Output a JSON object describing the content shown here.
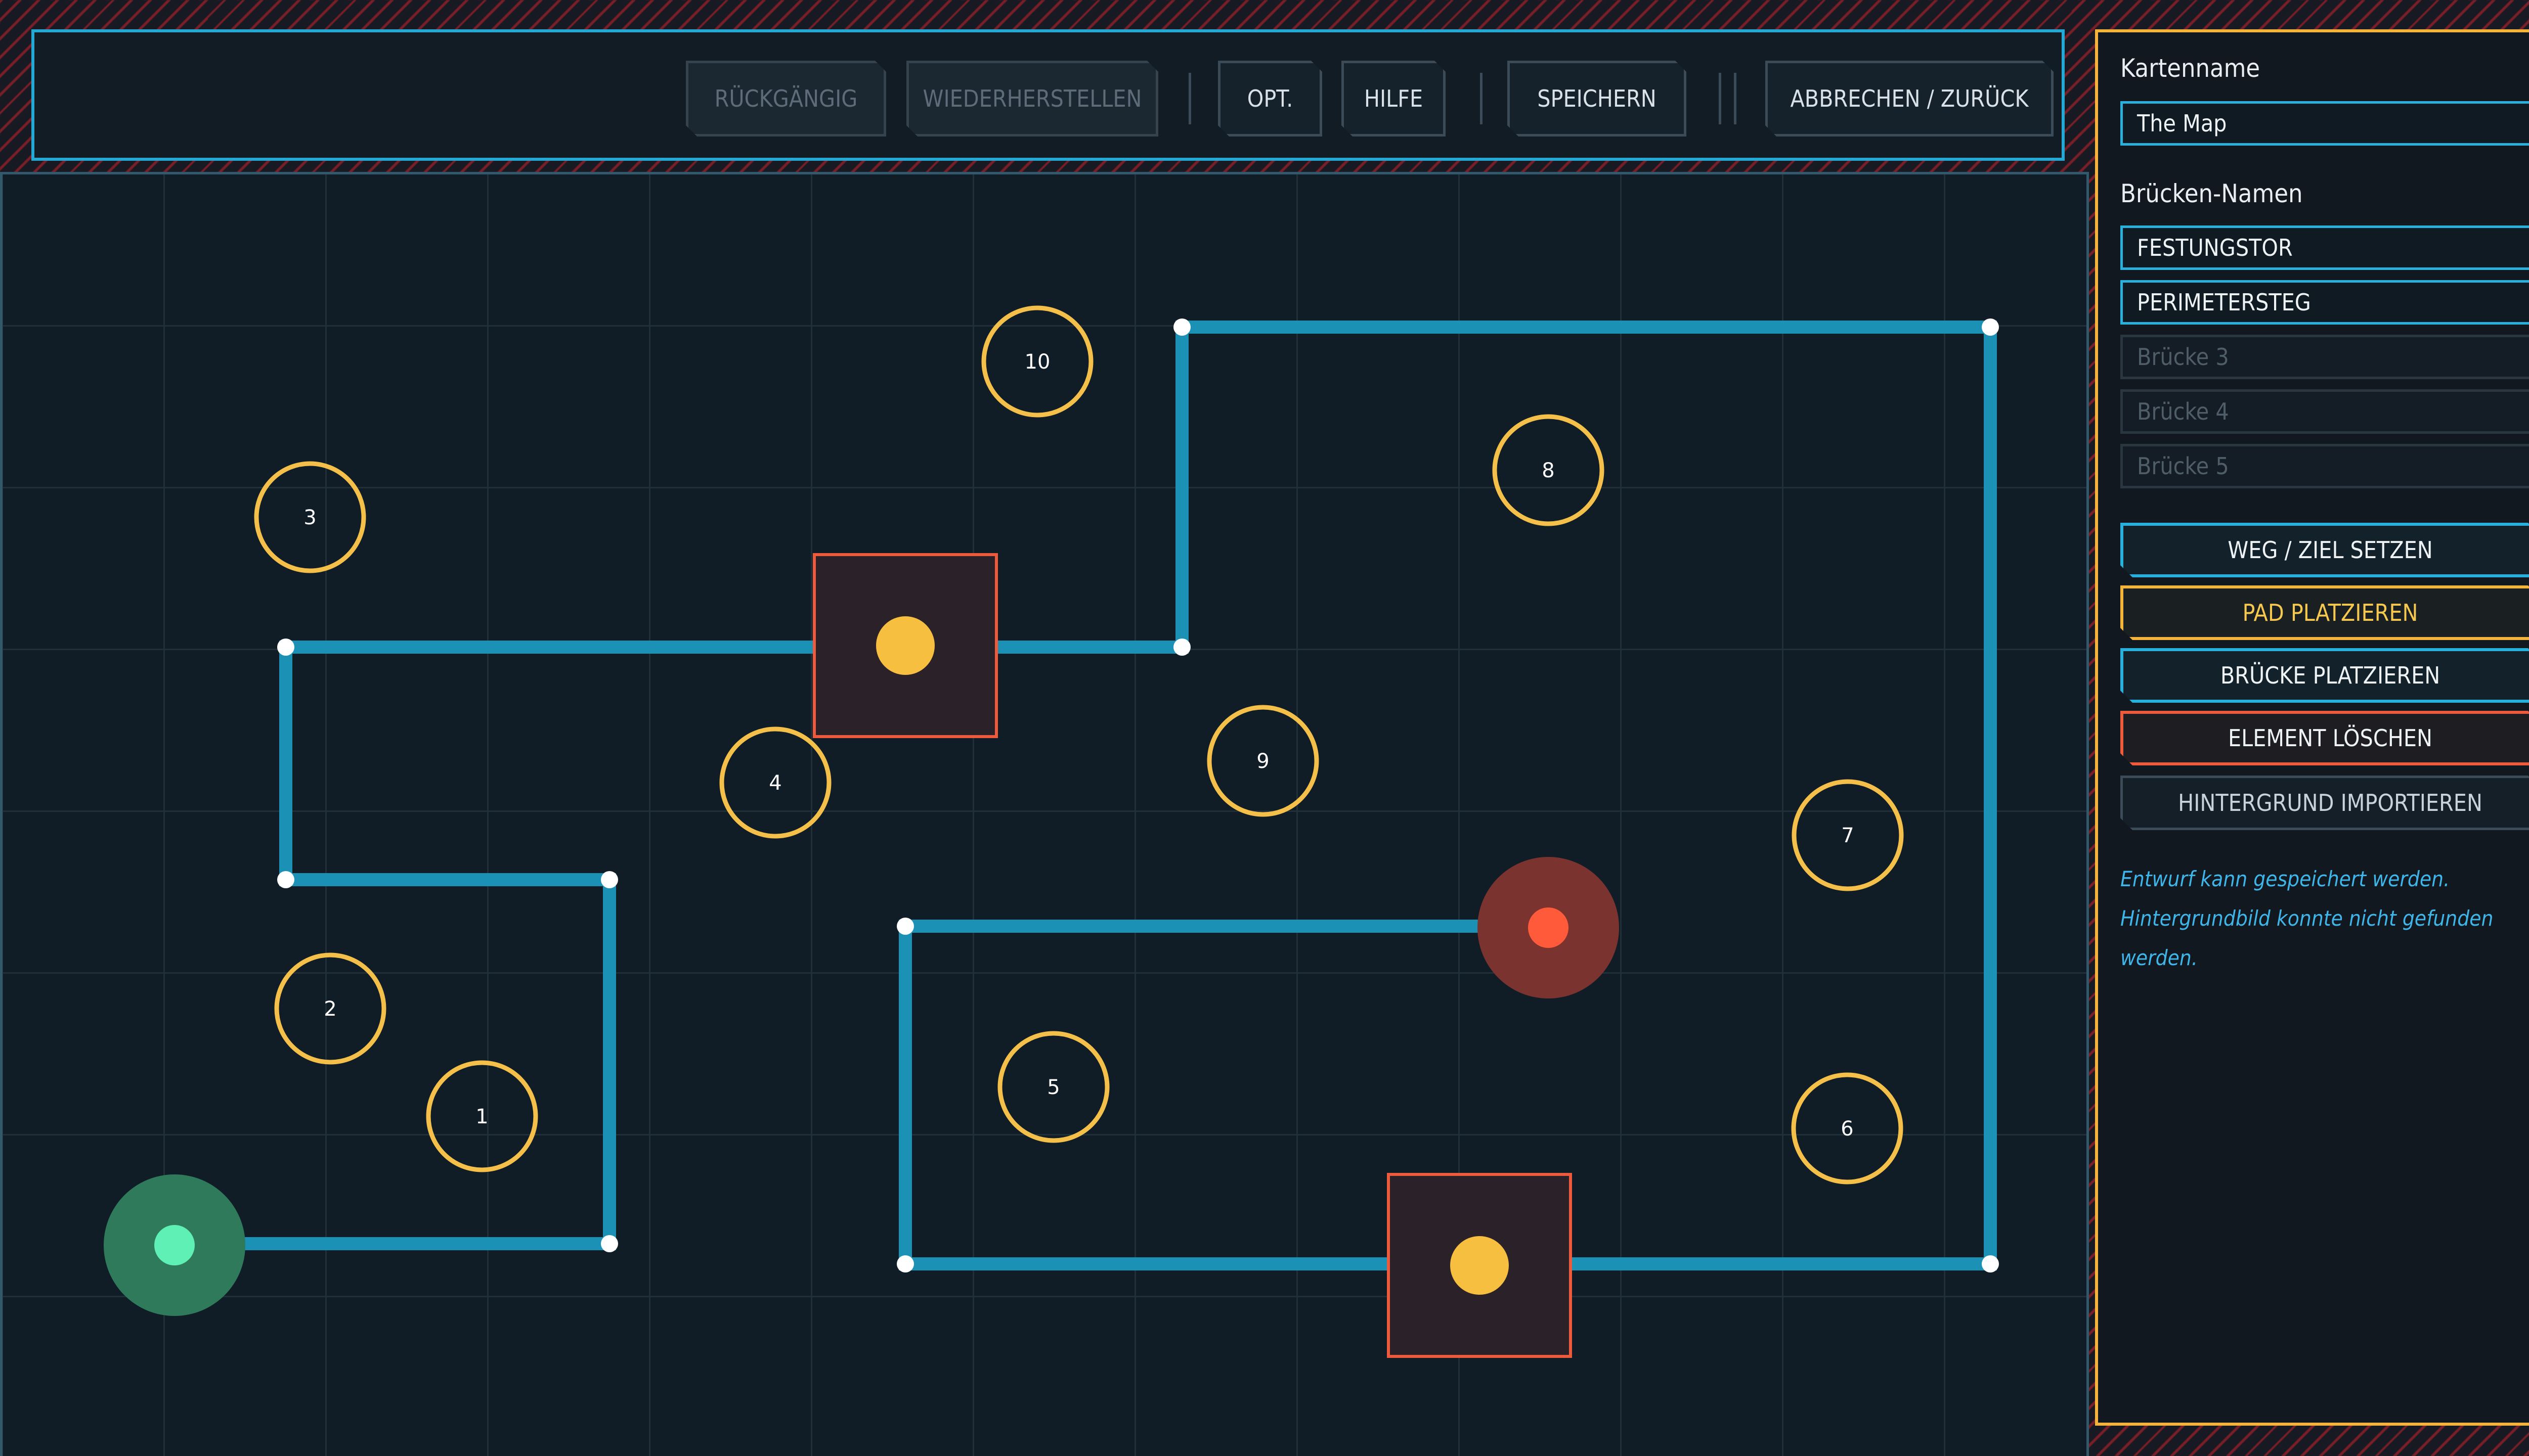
{
  "colors": {
    "accent_cyan": "#25a8d4",
    "accent_yellow": "#f4b33a",
    "accent_red": "#ee5a3c",
    "path_blue": "#1b92b5",
    "start_green": "#5ef0b5",
    "stripe_red": "#7a1e28"
  },
  "toolbar": {
    "undo_label": "RÜCKGÄNGIG",
    "redo_label": "WIEDERHERSTELLEN",
    "options_label": "OPT.",
    "help_label": "HILFE",
    "save_label": "SPEICHERN",
    "cancel_label": "ABBRECHEN / ZURÜCK"
  },
  "sidebar": {
    "map_name_label": "Kartenname",
    "map_name_value": "The Map",
    "bridge_names_label": "Brücken-Namen",
    "bridges": [
      {
        "value": "FESTUNGSTOR",
        "placeholder": ""
      },
      {
        "value": "PERIMETERSTEG",
        "placeholder": ""
      },
      {
        "value": "",
        "placeholder": "Brücke 3"
      },
      {
        "value": "",
        "placeholder": "Brücke 4"
      },
      {
        "value": "",
        "placeholder": "Brücke 5"
      }
    ],
    "buttons": {
      "set_path": "WEG / ZIEL SETZEN",
      "place_pad": "PAD PLATZIEREN",
      "place_bridge": "BRÜCKE PLATZIEREN",
      "delete_element": "ELEMENT LÖSCHEN",
      "import_background": "HINTERGRUND IMPORTIEREN"
    },
    "status_lines": [
      "Entwurf kann gespeichert werden.",
      "Hintergrundbild konnte nicht gefunden",
      "werden."
    ]
  },
  "map": {
    "pads": [
      "1",
      "2",
      "3",
      "4",
      "5",
      "6",
      "7",
      "8",
      "9",
      "10"
    ],
    "icons": [
      "start-marker",
      "goal-marker",
      "bridge-marker"
    ]
  }
}
